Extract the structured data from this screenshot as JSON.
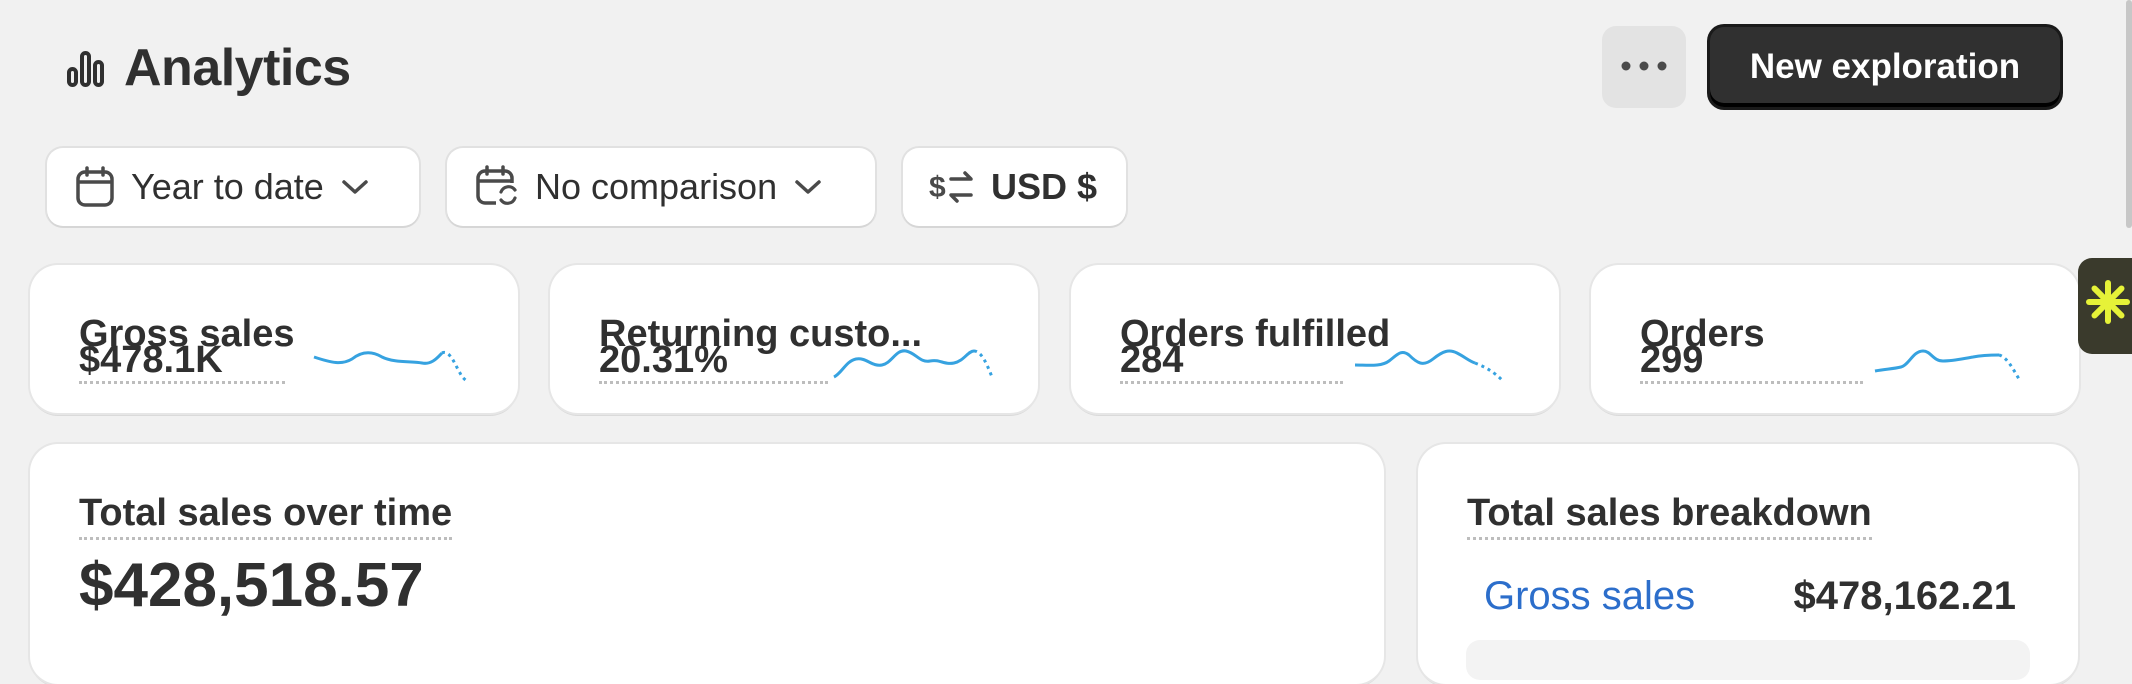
{
  "header": {
    "title": "Analytics",
    "title_icon": "bar-chart-icon",
    "more_icon": "ellipsis-icon",
    "primary_button": "New exploration"
  },
  "filters": [
    {
      "label": "Year to date",
      "icon": "calendar-icon",
      "has_dropdown": true
    },
    {
      "label": "No comparison",
      "icon": "calendar-compare-icon",
      "has_dropdown": true
    },
    {
      "label": "USD $",
      "icon": "currency-exchange-icon",
      "has_dropdown": false
    }
  ],
  "kpis": [
    {
      "label": "Gross sales",
      "value": "$478.1K"
    },
    {
      "label": "Returning custo...",
      "value": "20.31%"
    },
    {
      "label": "Orders fulfilled",
      "value": "284"
    },
    {
      "label": "Orders",
      "value": "299"
    }
  ],
  "panels": {
    "sales_over_time": {
      "title": "Total sales over time",
      "value": "$428,518.57"
    },
    "breakdown": {
      "title": "Total sales breakdown",
      "row_label": "Gross sales",
      "row_value": "$478,162.21"
    }
  },
  "widget_icon": "asterisk-icon",
  "colors": {
    "background": "#f1f1f1",
    "card": "#ffffff",
    "primary_button": "#303030",
    "link": "#2c6ecb",
    "sparkline": "#36a2e0",
    "widget": "#3a3a2c",
    "widget_accent": "#e6f238"
  }
}
